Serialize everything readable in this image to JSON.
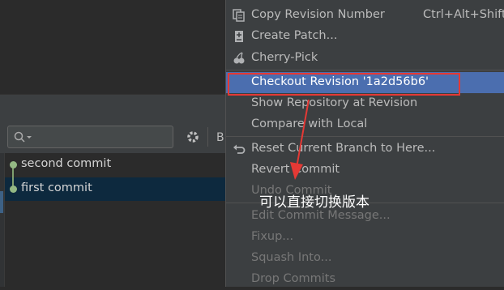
{
  "log": {
    "toolbar_label": "B",
    "commits": [
      {
        "label": "second commit"
      },
      {
        "label": "first commit"
      }
    ]
  },
  "menu": {
    "items": [
      {
        "label": "Copy Revision Number",
        "shortcut": "Ctrl+Alt+Shift+C",
        "icon": "copy-icon"
      },
      {
        "label": "Create Patch...",
        "icon": "patch-icon"
      },
      {
        "label": "Cherry-Pick",
        "icon": "cherry-icon"
      },
      {
        "label": "Checkout Revision '1a2d56b6'"
      },
      {
        "label": "Show Repository at Revision"
      },
      {
        "label": "Compare with Local"
      },
      {
        "label": "Reset Current Branch to Here...",
        "icon": "reset-icon"
      },
      {
        "label": "Revert Commit"
      },
      {
        "label": "Undo Commit"
      },
      {
        "label": "Edit Commit Message..."
      },
      {
        "label": "Fixup..."
      },
      {
        "label": "Squash Into..."
      },
      {
        "label": "Drop Commits"
      }
    ]
  },
  "annotation": {
    "text": "可以直接切换版本",
    "color": "#e53935"
  },
  "colors": {
    "highlight": "#4b6eaf",
    "accent": "#e53935"
  }
}
